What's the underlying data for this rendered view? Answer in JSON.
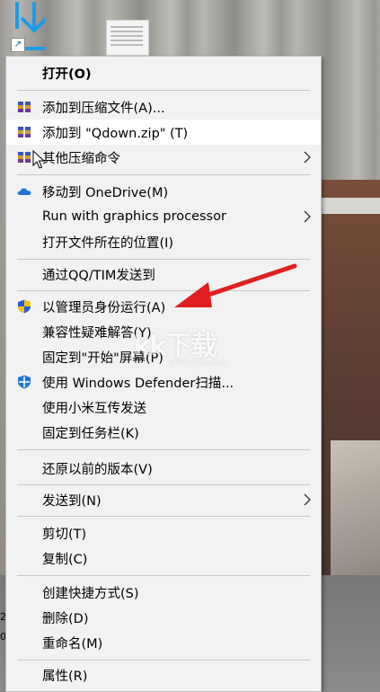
{
  "desktop": {
    "left_fragments": [
      "2",
      "0"
    ],
    "watermark": {
      "logo": "kk下载",
      "url": "www.kkx.net"
    }
  },
  "menu": {
    "items": [
      {
        "label": "打开(O)",
        "bold": true
      },
      {
        "label": "添加到压缩文件(A)...",
        "icon": "archive-icon"
      },
      {
        "label": "添加到 \"Qdown.zip\" (T)",
        "icon": "archive-icon",
        "highlighted": true
      },
      {
        "label": "其他压缩命令",
        "icon": "archive-icon",
        "submenu": true
      },
      {
        "label": "移动到 OneDrive(M)",
        "icon": "onedrive-cloud-icon"
      },
      {
        "label": "Run with graphics processor",
        "submenu": true
      },
      {
        "label": "打开文件所在的位置(I)"
      },
      {
        "label": "通过QQ/TIM发送到"
      },
      {
        "label": "以管理员身份运行(A)",
        "icon": "uac-shield-icon"
      },
      {
        "label": "兼容性疑难解答(Y)"
      },
      {
        "label": "固定到\"开始\"屏幕(P)"
      },
      {
        "label": "使用 Windows Defender扫描...",
        "icon": "defender-shield-icon"
      },
      {
        "label": "使用小米互传发送"
      },
      {
        "label": "固定到任务栏(K)"
      },
      {
        "label": "还原以前的版本(V)"
      },
      {
        "label": "发送到(N)",
        "submenu": true
      },
      {
        "label": "剪切(T)"
      },
      {
        "label": "复制(C)"
      },
      {
        "label": "创建快捷方式(S)"
      },
      {
        "label": "删除(D)"
      },
      {
        "label": "重命名(M)"
      },
      {
        "label": "属性(R)"
      }
    ]
  },
  "colors": {
    "menu_bg": "#f2f2f2",
    "highlight_bg": "#ffffff",
    "separator": "#c8c8c8",
    "annotation_arrow": "#e02020",
    "onedrive_blue": "#1e73d8",
    "defender_blue": "#1e78d4"
  }
}
